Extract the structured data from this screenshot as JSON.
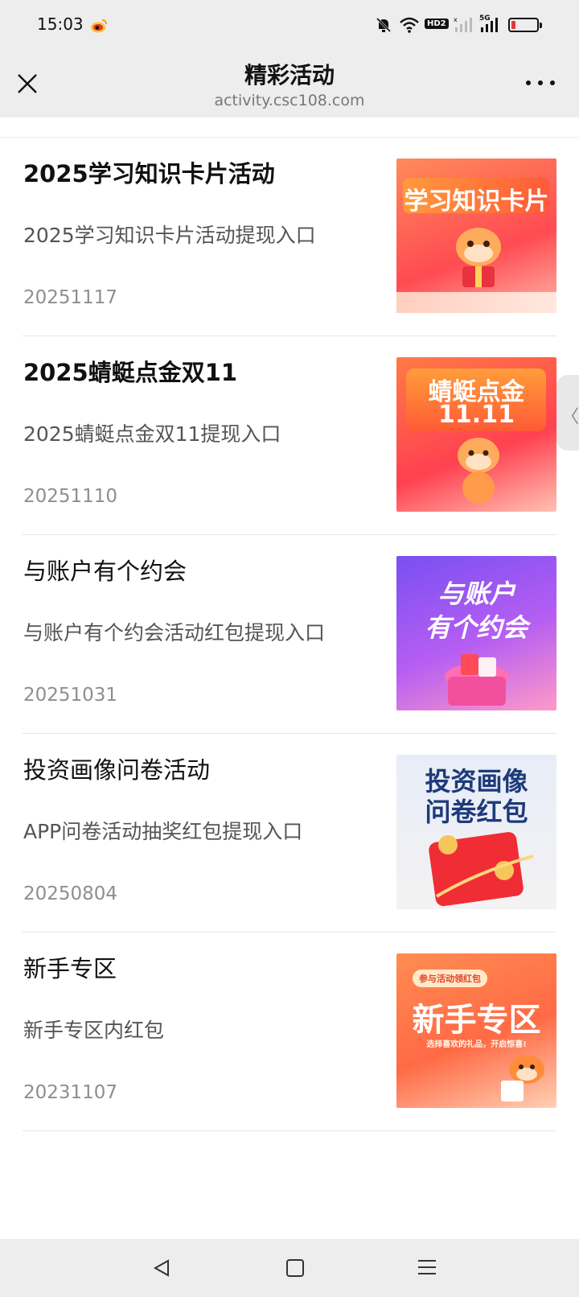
{
  "status_bar": {
    "time": "15:03",
    "icons": [
      "weibo-icon",
      "mute-bell-icon",
      "wifi-icon",
      "hd-badge-icon",
      "signal-icon",
      "signal-5g-icon",
      "battery-icon"
    ],
    "hd_label": "HD2",
    "network_label": "5G",
    "battery_level": 0.15,
    "battery_color": "#e53935"
  },
  "header": {
    "title": "精彩活动",
    "url": "activity.csc108.com",
    "close_icon": "close-icon",
    "more_icon": "more-icon"
  },
  "activities": [
    {
      "title": "2025学习知识卡片活动",
      "description": "2025学习知识卡片活动提现入口",
      "date": "20251117",
      "thumb_text": "学习知识卡片",
      "thumb_colors": [
        "#ff7a4d",
        "#ff3b4e"
      ]
    },
    {
      "title": "2025蜻蜓点金双11",
      "description": "2025蜻蜓点金双11提现入口",
      "date": "20251110",
      "thumb_text_line1": "蜻蜓点金",
      "thumb_text_line2": "11.11",
      "thumb_colors": [
        "#ff6a3d",
        "#ff3a4a"
      ]
    },
    {
      "title": "与账户有个约会",
      "description": "与账户有个约会活动红包提现入口",
      "date": "20251031",
      "thumb_text_line1": "与账户",
      "thumb_text_line2": "有个约会",
      "thumb_colors": [
        "#8a5cf6",
        "#c45bf0"
      ]
    },
    {
      "title": "投资画像问卷活动",
      "description": "APP问卷活动抽奖红包提现入口",
      "date": "20250804",
      "thumb_text_line1": "投资画像",
      "thumb_text_line2": "问卷红包",
      "thumb_colors": [
        "#e9eef8",
        "#f7f0ec"
      ]
    },
    {
      "title": "新手专区",
      "description": "新手专区内红包",
      "date": "20231107",
      "thumb_badge": "参与活动领红包",
      "thumb_text": "新手专区",
      "thumb_sub": "选择喜欢的礼品，开启惊喜!",
      "thumb_colors": [
        "#ff8a4c",
        "#ff5a3a"
      ]
    }
  ],
  "nav_bar": {
    "icons": [
      "back-icon",
      "home-icon",
      "recent-apps-icon"
    ]
  }
}
